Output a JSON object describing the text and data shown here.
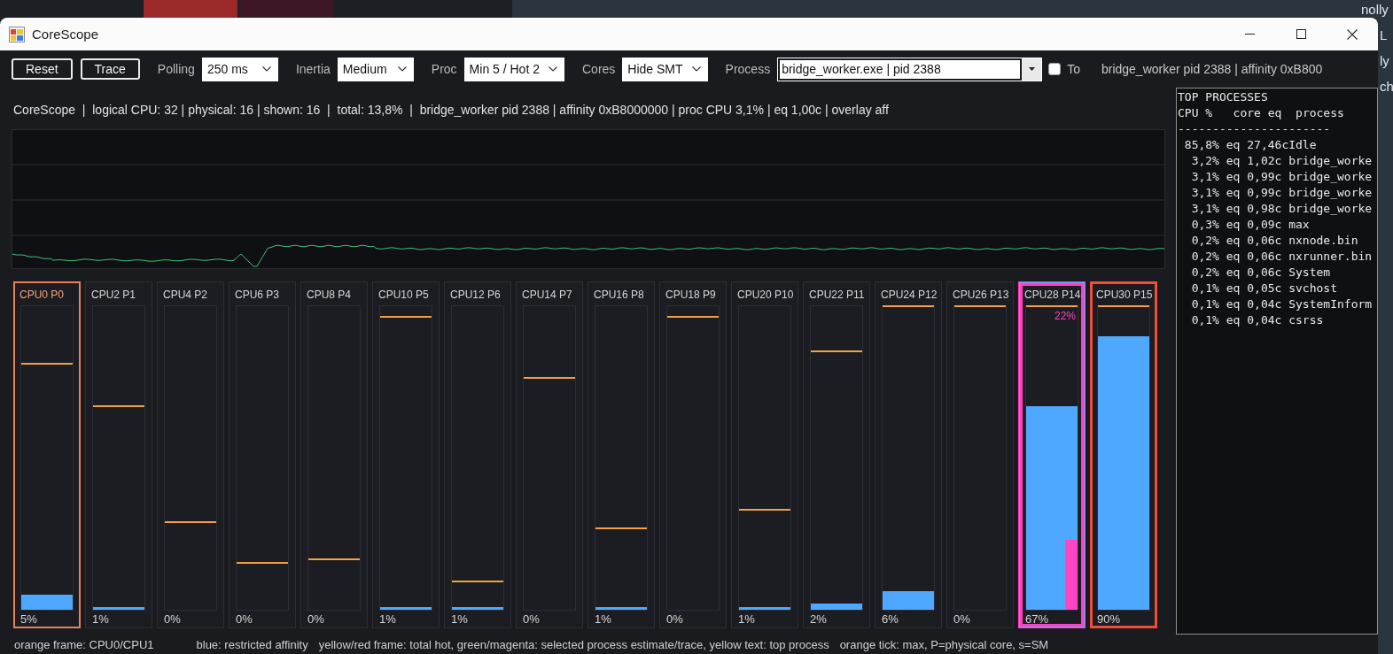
{
  "desktop": {
    "texts": [
      "nolly",
      "L",
      "ly",
      "ch"
    ]
  },
  "window": {
    "title": "CoreScope"
  },
  "toolbar": {
    "items": [
      {
        "kind": "button",
        "label": "Reset"
      },
      {
        "kind": "button",
        "label": "Trace"
      },
      {
        "kind": "select",
        "label": "Polling",
        "value": "250 ms"
      },
      {
        "kind": "select",
        "label": "Inertia",
        "value": "Medium"
      },
      {
        "kind": "select",
        "label": "Proc",
        "value": "Min 5 / Hot 2"
      },
      {
        "kind": "select",
        "label": "Cores",
        "value": "Hide SMT"
      },
      {
        "kind": "combo",
        "label": "Process",
        "value": "bridge_worker.exe | pid 2388"
      },
      {
        "kind": "checkbox",
        "label": "To",
        "checked": false
      },
      {
        "kind": "status",
        "text": "bridge_worker pid 2388 | affinity 0xB800"
      }
    ]
  },
  "summary": "CoreScope  |  logical CPU: 32 | physical: 16 | shown: 16  |  total: 13,8%  |  bridge_worker pid 2388 | affinity 0xB8000000 | proc CPU 3,1% | eq 1,00c | overlay aff",
  "cores": [
    {
      "label": "CPU0 P0",
      "percent": "5%",
      "level": 0.05,
      "max_tick": {
        "level": 0.81
      },
      "boot_core": true,
      "hot": false,
      "selected": false,
      "restricted": false
    },
    {
      "label": "CPU2 P1",
      "percent": "1%",
      "level": 0.01,
      "max_tick": {
        "level": 0.67
      },
      "boot_core": false,
      "hot": false,
      "selected": false,
      "restricted": false
    },
    {
      "label": "CPU4 P2",
      "percent": "0%",
      "level": 0,
      "max_tick": {
        "level": 0.29
      },
      "boot_core": false,
      "hot": false,
      "selected": false,
      "restricted": false
    },
    {
      "label": "CPU6 P3",
      "percent": "0%",
      "level": 0,
      "max_tick": {
        "level": 0.155
      },
      "boot_core": false,
      "hot": false,
      "selected": false,
      "restricted": false
    },
    {
      "label": "CPU8 P4",
      "percent": "0%",
      "level": 0,
      "max_tick": {
        "level": 0.165
      },
      "boot_core": false,
      "hot": false,
      "selected": false,
      "restricted": false
    },
    {
      "label": "CPU10 P5",
      "percent": "1%",
      "level": 0.01,
      "max_tick": {
        "level": 0.965
      },
      "boot_core": false,
      "hot": false,
      "selected": false,
      "restricted": false
    },
    {
      "label": "CPU12 P6",
      "percent": "1%",
      "level": 0.01,
      "max_tick": {
        "level": 0.093
      },
      "boot_core": false,
      "hot": false,
      "selected": false,
      "restricted": false
    },
    {
      "label": "CPU14 P7",
      "percent": "0%",
      "level": 0,
      "max_tick": {
        "level": 0.765
      },
      "boot_core": false,
      "hot": false,
      "selected": false,
      "restricted": false
    },
    {
      "label": "CPU16 P8",
      "percent": "1%",
      "level": 0.01,
      "max_tick": {
        "level": 0.267
      },
      "boot_core": false,
      "hot": false,
      "selected": false,
      "restricted": false
    },
    {
      "label": "CPU18 P9",
      "percent": "0%",
      "level": 0,
      "max_tick": {
        "level": 0.965
      },
      "boot_core": false,
      "hot": false,
      "selected": false,
      "restricted": false
    },
    {
      "label": "CPU20 P10",
      "percent": "1%",
      "level": 0.01,
      "max_tick": {
        "level": 0.33
      },
      "boot_core": false,
      "hot": false,
      "selected": false,
      "restricted": false
    },
    {
      "label": "CPU22 P11",
      "percent": "2%",
      "level": 0.02,
      "max_tick": {
        "level": 0.85
      },
      "boot_core": false,
      "hot": false,
      "selected": false,
      "restricted": false
    },
    {
      "label": "CPU24 P12",
      "percent": "6%",
      "level": 0.06,
      "max_tick": {
        "level": 1
      },
      "boot_core": false,
      "hot": false,
      "selected": false,
      "restricted": false
    },
    {
      "label": "CPU26 P13",
      "percent": "0%",
      "level": 0,
      "max_tick": {
        "level": 1
      },
      "boot_core": false,
      "hot": false,
      "selected": false,
      "restricted": false
    },
    {
      "label": "CPU28 P14",
      "percent": "67%",
      "level": 0.67,
      "max_tick": {
        "level": 1
      },
      "boot_core": false,
      "hot": false,
      "selected": true,
      "restricted": true,
      "trace": {
        "label": "22%",
        "level": 0.23
      }
    },
    {
      "label": "CPU30 P15",
      "percent": "90%",
      "level": 0.9,
      "max_tick": {
        "level": 1
      },
      "boot_core": false,
      "hot": true,
      "selected": false,
      "restricted": false
    }
  ],
  "top_processes": {
    "title": "TOP PROCESSES",
    "header": "CPU %   core eq  process",
    "divider": "----------------------",
    "rows": [
      {
        "cpu": "85,8%",
        "core_eq": "eq 27,46c",
        "process": "Idle"
      },
      {
        "cpu": "3,2%",
        "core_eq": "eq 1,02c",
        "process": "bridge_worke"
      },
      {
        "cpu": "3,1%",
        "core_eq": "eq 0,99c",
        "process": "bridge_worke"
      },
      {
        "cpu": "3,1%",
        "core_eq": "eq 0,99c",
        "process": "bridge_worke"
      },
      {
        "cpu": "3,1%",
        "core_eq": "eq 0,98c",
        "process": "bridge_worke"
      },
      {
        "cpu": "0,3%",
        "core_eq": "eq 0,09c",
        "process": "max"
      },
      {
        "cpu": "0,2%",
        "core_eq": "eq 0,06c",
        "process": "nxnode.bin"
      },
      {
        "cpu": "0,2%",
        "core_eq": "eq 0,06c",
        "process": "nxrunner.bin"
      },
      {
        "cpu": "0,2%",
        "core_eq": "eq 0,06c",
        "process": "System"
      },
      {
        "cpu": "0,1%",
        "core_eq": "eq 0,05c",
        "process": "svchost"
      },
      {
        "cpu": "0,1%",
        "core_eq": "eq 0,04c",
        "process": "SystemInform"
      },
      {
        "cpu": "0,1%",
        "core_eq": "eq 0,04c",
        "process": "csrss"
      }
    ]
  },
  "legend": [
    "orange frame: CPU0/CPU1",
    "blue: restricted affinity",
    "yellow/red frame: total hot, green/magenta: selected process estimate/trace, yellow text: top process",
    "orange tick: max, P=physical core, s=SM"
  ]
}
